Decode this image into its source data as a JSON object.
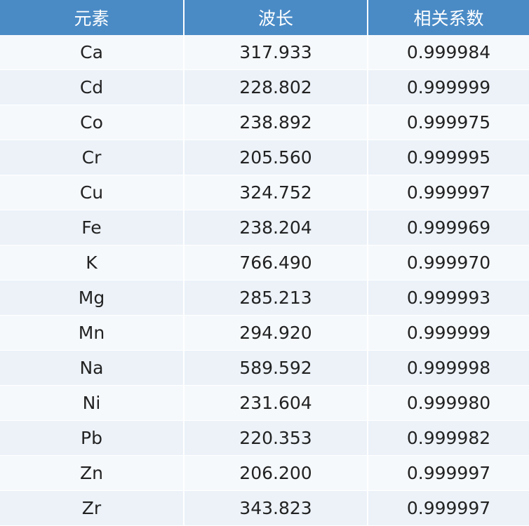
{
  "table": {
    "headers": [
      "元素",
      "波长",
      "相关系数"
    ],
    "rows": [
      [
        "Ca",
        "317.933",
        "0.999984"
      ],
      [
        "Cd",
        "228.802",
        "0.999999"
      ],
      [
        "Co",
        "238.892",
        "0.999975"
      ],
      [
        "Cr",
        "205.560",
        "0.999995"
      ],
      [
        "Cu",
        "324.752",
        "0.999997"
      ],
      [
        "Fe",
        "238.204",
        "0.999969"
      ],
      [
        "K",
        "766.490",
        "0.999970"
      ],
      [
        "Mg",
        "285.213",
        "0.999993"
      ],
      [
        "Mn",
        "294.920",
        "0.999999"
      ],
      [
        "Na",
        "589.592",
        "0.999998"
      ],
      [
        "Ni",
        "231.604",
        "0.999980"
      ],
      [
        "Pb",
        "220.353",
        "0.999982"
      ],
      [
        "Zn",
        "206.200",
        "0.999997"
      ],
      [
        "Zr",
        "343.823",
        "0.999997"
      ]
    ]
  },
  "colors": {
    "header_bg": "#4a8bc6",
    "header_text": "#ffffff",
    "row_odd": "#f6f9fc",
    "row_even": "#ecf2f8"
  }
}
